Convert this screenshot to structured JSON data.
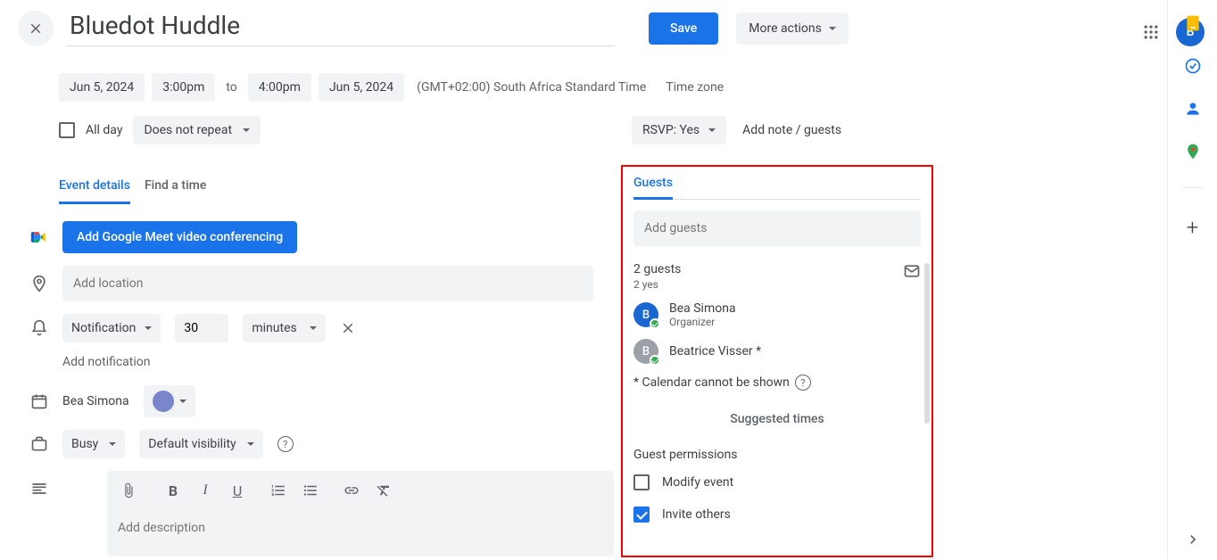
{
  "header": {
    "title": "Bluedot Huddle",
    "save": "Save",
    "more_actions": "More actions"
  },
  "datetime": {
    "start_date": "Jun 5, 2024",
    "start_time": "3:00pm",
    "to": "to",
    "end_time": "4:00pm",
    "end_date": "Jun 5, 2024",
    "timezone": "(GMT+02:00) South Africa Standard Time",
    "timezone_link": "Time zone"
  },
  "allday": {
    "label": "All day",
    "repeat": "Does not repeat"
  },
  "rsvp": {
    "label": "RSVP: Yes",
    "note_link": "Add note / guests"
  },
  "tabs": {
    "details": "Event details",
    "find": "Find a time"
  },
  "details": {
    "meet_button": "Add Google Meet video conferencing",
    "location_placeholder": "Add location",
    "notification_type": "Notification",
    "notification_value": "30",
    "notification_unit": "minutes",
    "add_notification": "Add notification",
    "owner": "Bea Simona",
    "busy": "Busy",
    "visibility": "Default visibility",
    "description_placeholder": "Add description"
  },
  "guests": {
    "tab": "Guests",
    "add_placeholder": "Add guests",
    "count": "2 guests",
    "yes_count": "2 yes",
    "list": [
      {
        "name": "Bea Simona",
        "role": "Organizer",
        "initial": "B",
        "color": "#1967d2"
      },
      {
        "name": "Beatrice Visser *",
        "role": "",
        "initial": "B",
        "color": "#9aa0a6"
      }
    ],
    "calendar_note": "* Calendar cannot be shown",
    "suggested": "Suggested times",
    "permissions_title": "Guest permissions",
    "perm_modify": "Modify event",
    "perm_invite": "Invite others"
  },
  "account": {
    "initial": "B"
  }
}
